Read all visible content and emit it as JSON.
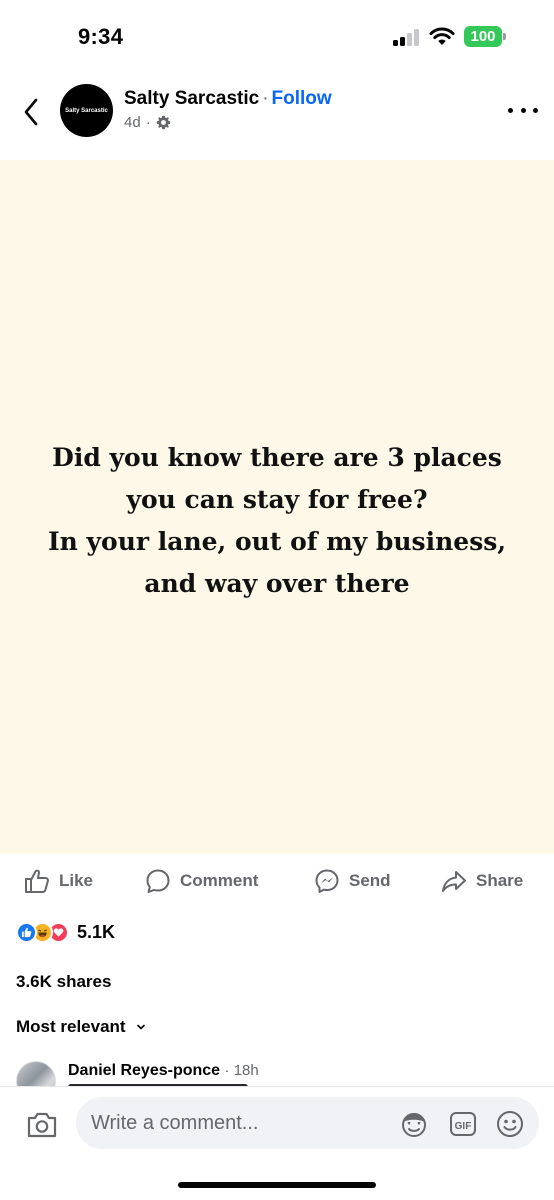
{
  "status_bar": {
    "time": "9:34",
    "battery": "100",
    "icons": [
      "signal-icon",
      "wifi-icon",
      "battery-icon"
    ],
    "battery_color": "#34c759"
  },
  "post": {
    "page_name": "Salty Sarcastic",
    "avatar_text": "Salty Sarcastic",
    "follow_label": "Follow",
    "time_ago": "4d",
    "privacy_icon": "gear-icon",
    "image_background": "#fdf8e8",
    "image_text_lines": [
      "Did you know there are 3 places",
      "you can stay for free?",
      "In your lane, out of my business,",
      "and way over there"
    ]
  },
  "actions": {
    "like": "Like",
    "comment": "Comment",
    "send": "Send",
    "share": "Share"
  },
  "engagement": {
    "reactions": [
      "like-icon",
      "haha-icon",
      "love-icon"
    ],
    "reaction_count": "5.1K",
    "shares": "3.6K shares",
    "sort_label": "Most relevant"
  },
  "comments": [
    {
      "author": "Daniel Reyes-ponce",
      "time": "18h"
    }
  ],
  "composer": {
    "placeholder": "Write a comment...",
    "icons": [
      "camera-icon",
      "avatar-sticker-icon",
      "gif-icon",
      "emoji-icon"
    ]
  },
  "colors": {
    "accent": "#0866ff",
    "secondary_text": "#65676b",
    "like_blue": "#1877f2",
    "love_red": "#f33e58",
    "haha_yellow": "#f7b125"
  }
}
